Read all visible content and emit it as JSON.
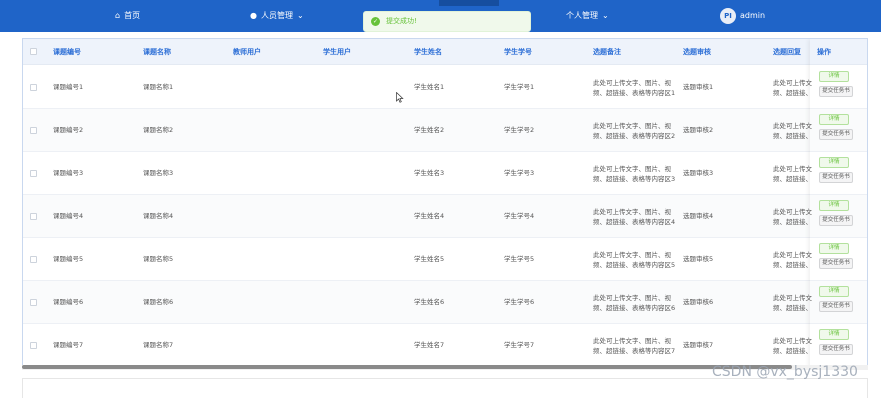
{
  "nav": {
    "home": "首页",
    "people": "人员管理",
    "personal": "个人管理",
    "avatar_initials": "PI",
    "username": "admin"
  },
  "toast": {
    "text": "提交成功!"
  },
  "colors": {
    "primary": "#1f64c8",
    "success": "#67c23a",
    "header_text": "#2d6fd6"
  },
  "table": {
    "columns": [
      "课题编号",
      "课题名称",
      "教师用户",
      "学生用户",
      "学生姓名",
      "学生学号",
      "选题备注",
      "选题审核",
      "选题回复",
      "操作"
    ],
    "rows": [
      {
        "code": "课题编号1",
        "name": "课题名称1",
        "teacher": "",
        "student_user": "",
        "student_name": "学生姓名1",
        "student_id": "学生学号1",
        "remark_1": "此处可上传文字、图片、视",
        "remark_2": "频、超链接、表格等内容区1",
        "review": "选题审核1",
        "reply_1": "此处可上传文",
        "reply_2": "频、超链接、"
      },
      {
        "code": "课题编号2",
        "name": "课题名称2",
        "teacher": "",
        "student_user": "",
        "student_name": "学生姓名2",
        "student_id": "学生学号2",
        "remark_1": "此处可上传文字、图片、视",
        "remark_2": "频、超链接、表格等内容区2",
        "review": "选题审核2",
        "reply_1": "此处可上传文",
        "reply_2": "频、超链接、"
      },
      {
        "code": "课题编号3",
        "name": "课题名称3",
        "teacher": "",
        "student_user": "",
        "student_name": "学生姓名3",
        "student_id": "学生学号3",
        "remark_1": "此处可上传文字、图片、视",
        "remark_2": "频、超链接、表格等内容区3",
        "review": "选题审核3",
        "reply_1": "此处可上传文",
        "reply_2": "频、超链接、"
      },
      {
        "code": "课题编号4",
        "name": "课题名称4",
        "teacher": "",
        "student_user": "",
        "student_name": "学生姓名4",
        "student_id": "学生学号4",
        "remark_1": "此处可上传文字、图片、视",
        "remark_2": "频、超链接、表格等内容区4",
        "review": "选题审核4",
        "reply_1": "此处可上传文",
        "reply_2": "频、超链接、"
      },
      {
        "code": "课题编号5",
        "name": "课题名称5",
        "teacher": "",
        "student_user": "",
        "student_name": "学生姓名5",
        "student_id": "学生学号5",
        "remark_1": "此处可上传文字、图片、视",
        "remark_2": "频、超链接、表格等内容区5",
        "review": "选题审核5",
        "reply_1": "此处可上传文",
        "reply_2": "频、超链接、"
      },
      {
        "code": "课题编号6",
        "name": "课题名称6",
        "teacher": "",
        "student_user": "",
        "student_name": "学生姓名6",
        "student_id": "学生学号6",
        "remark_1": "此处可上传文字、图片、视",
        "remark_2": "频、超链接、表格等内容区6",
        "review": "选题审核6",
        "reply_1": "此处可上传文",
        "reply_2": "频、超链接、"
      },
      {
        "code": "课题编号7",
        "name": "课题名称7",
        "teacher": "",
        "student_user": "",
        "student_name": "学生姓名7",
        "student_id": "学生学号7",
        "remark_1": "此处可上传文字、图片、视",
        "remark_2": "频、超链接、表格等内容区7",
        "review": "选题审核7",
        "reply_1": "此处可上传文",
        "reply_2": "频、超链接、"
      }
    ],
    "actions": {
      "detail": "详情",
      "submit": "提交任务书"
    }
  },
  "watermark": "CSDN @vx_bysj1330"
}
